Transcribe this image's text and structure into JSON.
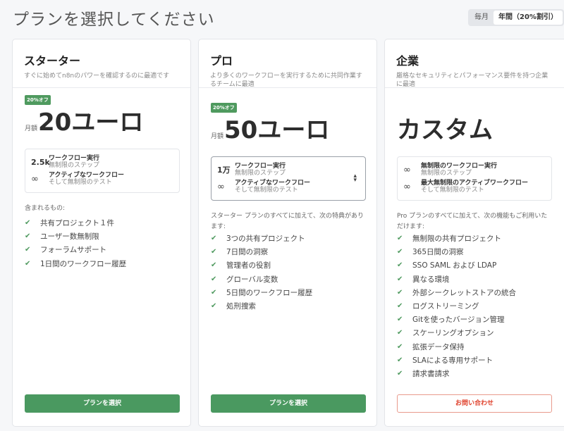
{
  "page": {
    "title": "プランを選択してください"
  },
  "billing": {
    "monthly": "毎月",
    "yearly": "年間（20%割引）",
    "selected": "yearly"
  },
  "plans": [
    {
      "title": "スターター",
      "desc": "すぐに始めてn8nのパワーを確認するのに最適です",
      "badge": "20%オフ",
      "price_prefix": "月額",
      "price": "20ユーロ",
      "box": [
        {
          "num": "2.5k",
          "main": "ワークフロー実行",
          "sub": "無制限のステップ"
        },
        {
          "icon": "infinity-icon",
          "main": "アクティブなワークフロー",
          "sub": "そして無制限のテスト"
        }
      ],
      "included_label": "含まれるもの:",
      "features": [
        "共有プロジェクト１件",
        "ユーザー数無制限",
        "フォーラムサポート",
        "1日間のワークフロー履歴"
      ],
      "button": "プランを選択"
    },
    {
      "title": "プロ",
      "desc": "より多くのワークフローを実行するために共同作業するチームに最適",
      "badge": "20%オフ",
      "price_prefix": "月額",
      "price": "50ユーロ",
      "box": [
        {
          "num": "1万",
          "main": "ワークフロー実行",
          "sub": "無制限のステップ"
        },
        {
          "icon": "infinity-icon",
          "main": "アクティブなワークフロー",
          "sub": "そして無制限のテスト"
        }
      ],
      "included_label": "スターター プランのすべてに加えて、次の特典があります:",
      "features": [
        "3つの共有プロジェクト",
        "7日間の洞察",
        "管理者の役割",
        "グローバル変数",
        "5日間のワークフロー履歴",
        "処刑捜索"
      ],
      "button": "プランを選択"
    },
    {
      "title": "企業",
      "desc": "厳格なセキュリティとパフォーマンス要件を持つ企業に最適",
      "price": "カスタム",
      "box": [
        {
          "icon": "infinity-icon",
          "main": "無制限のワークフロー実行",
          "sub": "無制限のステップ"
        },
        {
          "icon": "infinity-icon",
          "main": "最大無制限のアクティブワークフロー",
          "sub": "そして無制限のテスト"
        }
      ],
      "included_label": "Pro プランのすべてに加えて、次の機能もご利用いただけます:",
      "features": [
        "無制限の共有プロジェクト",
        "365日間の洞察",
        "SSO SAML および LDAP",
        "異なる環境",
        "外部シークレットストアの統合",
        "ログストリーミング",
        "Gitを使ったバージョン管理",
        "スケーリングオプション",
        "拡張データ保持",
        "SLAによる専用サポート",
        "請求書請求"
      ],
      "button": "お問い合わせ"
    }
  ],
  "colors": {
    "accent": "#4a9960",
    "contact": "#e0442f"
  }
}
